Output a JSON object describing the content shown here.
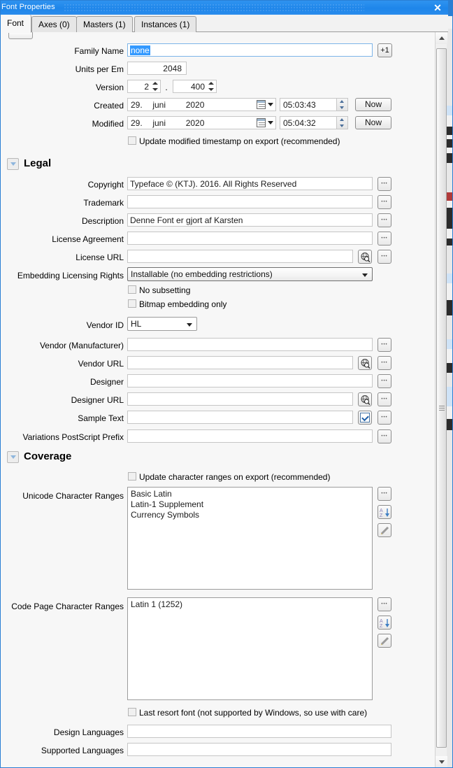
{
  "window": {
    "title": "Font Properties",
    "close_label": "✕"
  },
  "tabs": [
    {
      "label": "Font",
      "active": true
    },
    {
      "label": "Axes (0)",
      "active": false
    },
    {
      "label": "Masters (1)",
      "active": false
    },
    {
      "label": "Instances (1)",
      "active": false
    }
  ],
  "general": {
    "family_name_label": "Family Name",
    "family_name_value": "none",
    "family_name_add_label": "+1",
    "units_per_em_label": "Units per Em",
    "units_per_em_value": "2048",
    "version_label": "Version",
    "version_major": "2",
    "version_separator": ".",
    "version_minor": "400",
    "created_label": "Created",
    "created_day": "29.",
    "created_month": "juni",
    "created_year": "2020",
    "created_time": "05:03:43",
    "created_now_label": "Now",
    "modified_label": "Modified",
    "modified_day": "29.",
    "modified_month": "juni",
    "modified_year": "2020",
    "modified_time": "05:04:32",
    "modified_now_label": "Now",
    "update_timestamp_label": "Update modified timestamp on export (recommended)",
    "update_timestamp_checked": false
  },
  "legal": {
    "section_title": "Legal",
    "copyright_label": "Copyright",
    "copyright_value": "Typeface © (KTJ). 2016. All Rights Reserved",
    "trademark_label": "Trademark",
    "trademark_value": "",
    "description_label": "Description",
    "description_value": "Denne Font er gjort af Karsten",
    "license_agreement_label": "License Agreement",
    "license_agreement_value": "",
    "license_url_label": "License URL",
    "license_url_value": "",
    "embedding_label": "Embedding Licensing Rights",
    "embedding_value": "Installable (no embedding restrictions)",
    "no_subsetting_label": "No subsetting",
    "no_subsetting_checked": false,
    "bitmap_embedding_label": "Bitmap embedding only",
    "bitmap_embedding_checked": false,
    "vendor_id_label": "Vendor ID",
    "vendor_id_value": "HL",
    "vendor_manufacturer_label": "Vendor (Manufacturer)",
    "vendor_manufacturer_value": "",
    "vendor_url_label": "Vendor URL",
    "vendor_url_value": "",
    "designer_label": "Designer",
    "designer_value": "",
    "designer_url_label": "Designer URL",
    "designer_url_value": "",
    "sample_text_label": "Sample Text",
    "sample_text_value": "",
    "variations_prefix_label": "Variations PostScript Prefix",
    "variations_prefix_value": ""
  },
  "coverage": {
    "section_title": "Coverage",
    "update_ranges_label": "Update character ranges on export (recommended)",
    "update_ranges_checked": false,
    "unicode_ranges_label": "Unicode Character Ranges",
    "unicode_ranges_items": [
      "Basic Latin",
      "Latin-1 Supplement",
      "Currency Symbols"
    ],
    "code_page_ranges_label": "Code Page Character Ranges",
    "code_page_ranges_items": [
      "Latin 1 (1252)"
    ],
    "last_resort_label": "Last resort font (not supported by Windows, so use with care)",
    "last_resort_checked": false,
    "design_languages_label": "Design Languages",
    "design_languages_value": "",
    "supported_languages_label": "Supported Languages",
    "supported_languages_value": ""
  },
  "colors": {
    "titlebar": "#1e86ea",
    "selection": "#3399ff",
    "pane_bg": "#f7f7f7",
    "border": "#9c9c9c"
  }
}
